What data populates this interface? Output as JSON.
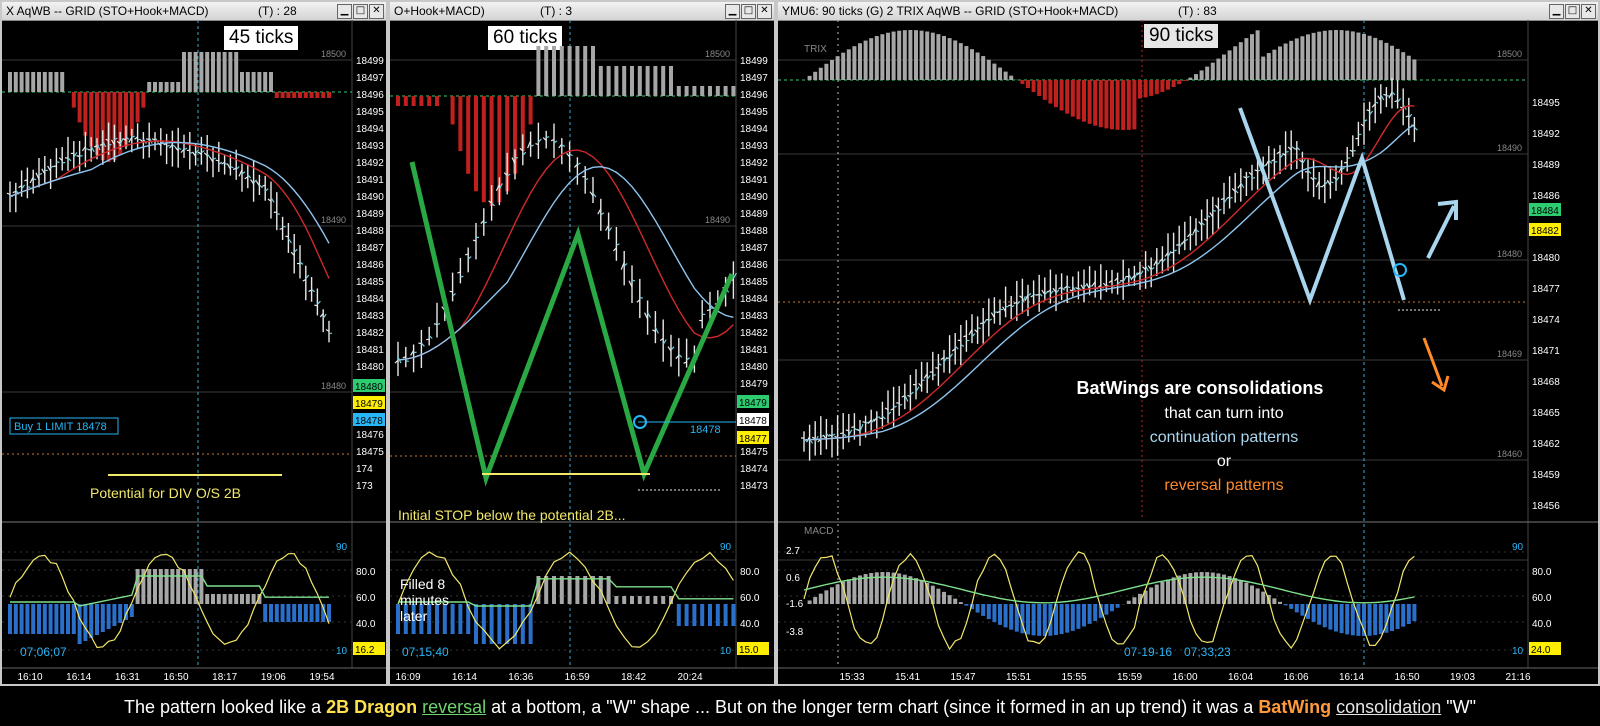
{
  "windows": [
    {
      "title": "X AqWB -- GRID (STO+Hook+MACD)",
      "t_label": "(T) : 28",
      "tick_tag": "45 ticks",
      "price_labels": [
        "18499",
        "18497",
        "18496",
        "18495",
        "18494",
        "18493",
        "18492",
        "18491",
        "18490",
        "18489",
        "18488",
        "18487",
        "18486",
        "18485",
        "18484",
        "18483",
        "18482",
        "18481",
        "18480",
        "18479",
        "18478",
        "18477",
        "18476",
        "18475",
        "174",
        "173"
      ],
      "grid_labels": [
        "18500",
        "18490",
        "18480"
      ],
      "boxes": [
        {
          "text": "18480",
          "color": "#2ecc71"
        },
        {
          "text": "18479",
          "color": "#ffee00"
        },
        {
          "text": "18478",
          "color": "#29b6f6"
        }
      ],
      "order_label": "Buy 1 LIMIT 18478",
      "annotation": "Potential for DIV O/S 2B",
      "osc_labels": [
        "90",
        "80.0",
        "60.0",
        "40.0",
        "10",
        "16.2"
      ],
      "time_stamp": "07;06;07",
      "time_axis": [
        "16:10",
        "16:14",
        "16:31",
        "16:50",
        "18:17",
        "19:06",
        "19:54"
      ]
    },
    {
      "title": "O+Hook+MACD)",
      "t_label": "(T) : 3",
      "tick_tag": "60 ticks",
      "price_labels": [
        "18499",
        "18497",
        "18496",
        "18495",
        "18494",
        "18493",
        "18492",
        "18491",
        "18490",
        "18489",
        "18488",
        "18487",
        "18486",
        "18485",
        "18484",
        "18483",
        "18482",
        "18481",
        "18480",
        "18479",
        "18478",
        "18477",
        "18476",
        "18475",
        "18474",
        "18473"
      ],
      "grid_labels": [
        "18500",
        "18490"
      ],
      "boxes": [
        {
          "text": "18479",
          "color": "#2ecc71"
        },
        {
          "text": "18478",
          "color": "#ffffff"
        },
        {
          "text": "18477",
          "color": "#ffee00"
        }
      ],
      "order_label": "18478",
      "annotation": "Initial STOP below the potential 2B...",
      "osc_labels": [
        "90",
        "80.0",
        "60.0",
        "40.0",
        "10",
        "15.0"
      ],
      "filled_note": "Filled 8 minutes later",
      "time_stamp": "07;15;40",
      "time_axis": [
        "16:09",
        "16:14",
        "16:36",
        "16:59",
        "18:42",
        "20:24"
      ]
    },
    {
      "title": "YMU6: 90 ticks (G) 2 TRIX AqWB -- GRID (STO+Hook+MACD)",
      "t_label": "(T) : 83",
      "tick_tag": "90 ticks",
      "study_label": "TRIX",
      "price_labels": [
        "18495",
        "18492",
        "18489",
        "18486",
        "18483",
        "18480",
        "18477",
        "18474",
        "18471",
        "18468",
        "18465",
        "18462",
        "18459",
        "18456"
      ],
      "grid_labels": [
        "18500",
        "18490",
        "18480",
        "18469",
        "18460"
      ],
      "boxes": [
        {
          "text": "18484",
          "color": "#2ecc71"
        },
        {
          "text": "18482",
          "color": "#ffee00"
        }
      ],
      "headline": "BatWings are consolidations",
      "line1": "that can turn into",
      "line2": "continuation patterns",
      "line3": "or",
      "line4": "reversal patterns",
      "macd_label": "MACD",
      "osc_labels": [
        "90",
        "80.0",
        "60.0",
        "40.0",
        "10",
        "24.0"
      ],
      "macd_levels": [
        "2.7",
        "0.6",
        "-1.6",
        "-3.8"
      ],
      "date_stamp": "07-19-16",
      "time_stamp": "07;33;23",
      "time_axis": [
        "15:33",
        "15:41",
        "15:47",
        "15:51",
        "15:55",
        "15:59",
        "16:00",
        "16:04",
        "16:06",
        "16:14",
        "16:50",
        "19:03",
        "21:16"
      ]
    }
  ],
  "caption": {
    "p1": "The pattern looked like a ",
    "p2": "2B Dragon",
    "p3": " ",
    "p4": "reversal",
    "p5": " at a bottom, a \"W\" shape ... But on the longer term chart (since it formed in an up trend) it was a ",
    "p6": "BatWing",
    "p7": " ",
    "p8": "consolidation",
    "p9": " \"W\""
  },
  "colors": {
    "bullish_bar": "#a6a6a6",
    "bearish_bar": "#c0201e",
    "histo_blue": "#2a6fc9",
    "pattern_green": "#2aa844",
    "batwing_blue": "#a9d6ee",
    "reversal_orange": "#ff8a2a",
    "annotation_yellow": "#f2e86a"
  }
}
